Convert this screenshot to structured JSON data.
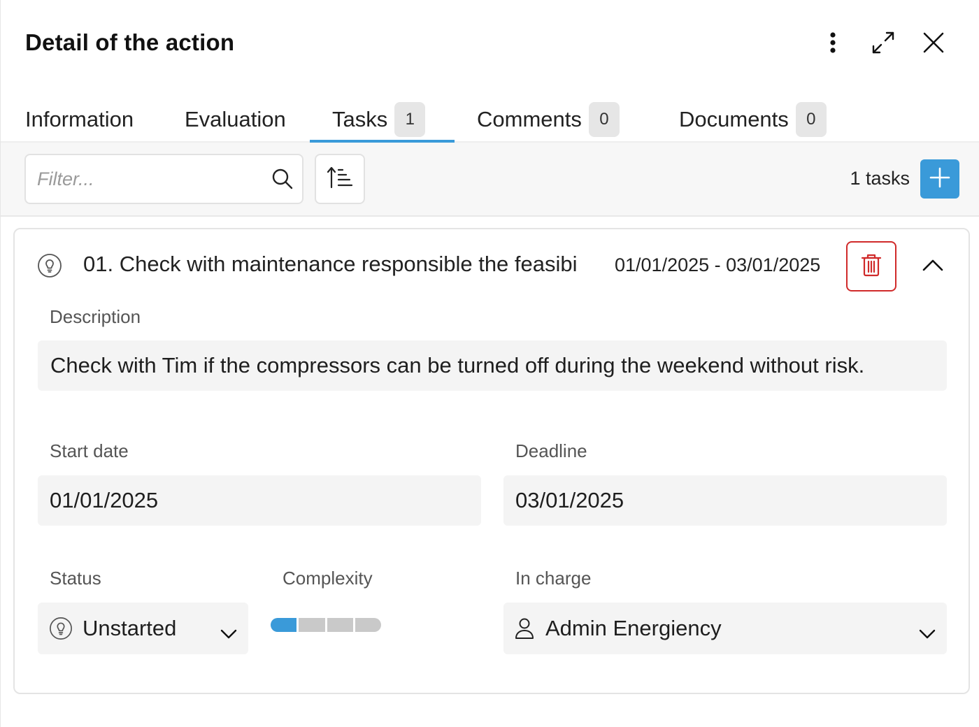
{
  "header": {
    "title": "Detail of the action",
    "icons": [
      "more-vertical-icon",
      "expand-icon",
      "close-icon"
    ]
  },
  "tabs": [
    {
      "label": "Information",
      "badge": null,
      "active": false
    },
    {
      "label": "Evaluation",
      "badge": null,
      "active": false
    },
    {
      "label": "Tasks",
      "badge": "1",
      "active": true
    },
    {
      "label": "Comments",
      "badge": "0",
      "active": false
    },
    {
      "label": "Documents",
      "badge": "0",
      "active": false
    }
  ],
  "toolbar": {
    "filter_placeholder": "Filter...",
    "filter_value": "",
    "count_text": "1 tasks"
  },
  "task": {
    "title": "01. Check with maintenance responsible the feasibi",
    "date_range": "01/01/2025 - 03/01/2025",
    "description_label": "Description",
    "description": "Check with Tim if the compressors can be turned off during the weekend without risk.",
    "start_label": "Start date",
    "start_date": "01/01/2025",
    "deadline_label": "Deadline",
    "deadline": "03/01/2025",
    "status_label": "Status",
    "status": "Unstarted",
    "complexity_label": "Complexity",
    "complexity_level": 1,
    "complexity_max": 4,
    "in_charge_label": "In charge",
    "in_charge": "Admin Energiency"
  },
  "colors": {
    "accent": "#3a9ad9",
    "danger": "#d02a2a",
    "field_bg": "#f4f4f4",
    "toolbar_bg": "#f7f7f7"
  }
}
